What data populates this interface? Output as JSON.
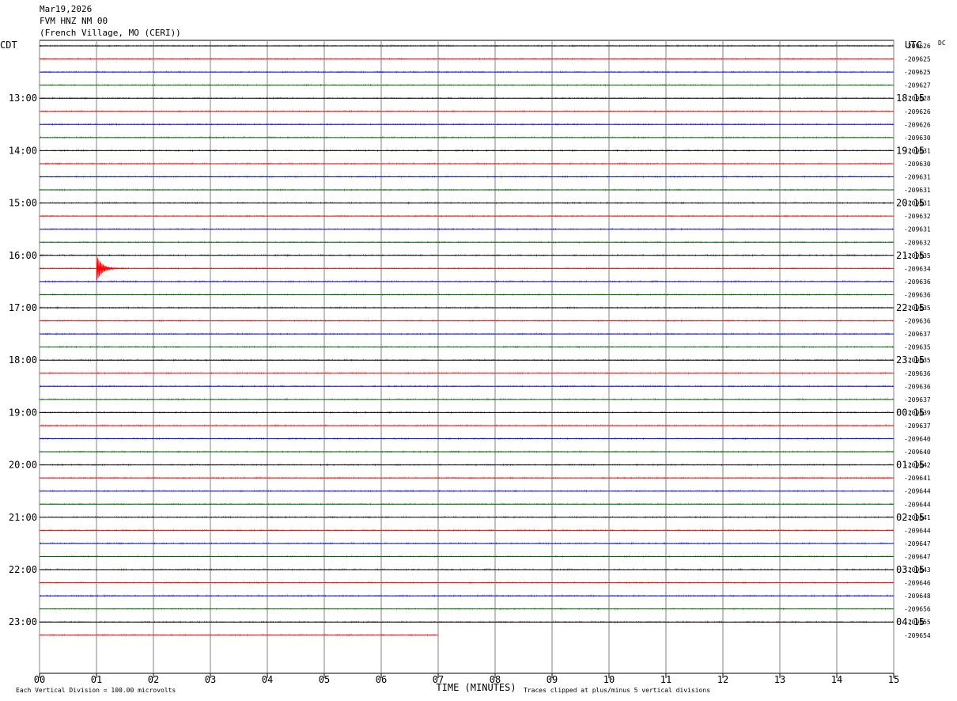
{
  "header": {
    "date": "Mar19,2026",
    "station": "FVM HNZ NM 00",
    "location": "(French Village, MO (CERI))"
  },
  "chart_data": {
    "type": "line",
    "left_tz": "CDT",
    "right_tz": "UTC",
    "dc_label": "DC",
    "xlabel": "TIME (MINUTES)",
    "xlim": [
      0,
      15
    ],
    "xticks": [
      "00",
      "01",
      "02",
      "03",
      "04",
      "05",
      "06",
      "07",
      "08",
      "09",
      "10",
      "11",
      "12",
      "13",
      "14",
      "15"
    ],
    "footer_left": "Each Vertical Division =  100.00 microvolts",
    "footer_right": "Traces clipped at plus/minus 5 vertical divisions",
    "trace_colors": [
      "#000000",
      "#ff0000",
      "#0000ff",
      "#006400"
    ],
    "hour_labels_left": [
      "13:00",
      "14:00",
      "15:00",
      "16:00",
      "17:00",
      "18:00",
      "19:00",
      "20:00",
      "21:00",
      "22:00",
      "23:00"
    ],
    "hour_labels_right": [
      "18:15",
      "19:15",
      "20:15",
      "21:15",
      "22:15",
      "23:15",
      "00:15",
      "01:15",
      "02:15",
      "03:15",
      "04:15"
    ],
    "hour_label_first_trace": 4,
    "dc_offsets": [
      "-209626",
      "-209625",
      "-209625",
      "-209627",
      "-209628",
      "-209626",
      "-209626",
      "-209630",
      "-209631",
      "-209630",
      "-209631",
      "-209631",
      "-209631",
      "-209632",
      "-209631",
      "-209632",
      "-209635",
      "-209634",
      "-209636",
      "-209636",
      "-209635",
      "-209636",
      "-209637",
      "-209635",
      "-209635",
      "-209636",
      "-209636",
      "-209637",
      "-209639",
      "-209637",
      "-209640",
      "-209640",
      "-209642",
      "-209641",
      "-209644",
      "-209644",
      "-209641",
      "-209644",
      "-209647",
      "-209647",
      "-209643",
      "-209646",
      "-209648",
      "-209656",
      "-209655",
      "-209654"
    ],
    "trace_count": 46,
    "last_trace_end_minute": 7.0,
    "events": [
      {
        "trace": 17,
        "minute": 1.0,
        "amplitude_divisions": 1.0
      }
    ]
  }
}
